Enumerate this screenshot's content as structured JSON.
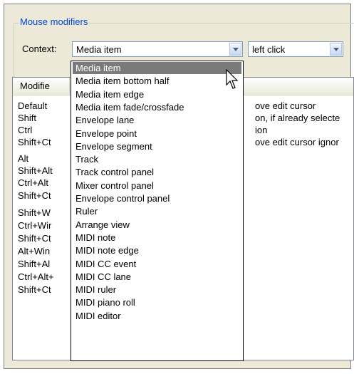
{
  "group_title": "Mouse modifiers",
  "context": {
    "label": "Context:",
    "selected": "Media item",
    "action": "left click"
  },
  "list": {
    "header_modifier": "Modifie",
    "rows": [
      {
        "modifier": "Default",
        "action": "ove edit cursor"
      },
      {
        "modifier": "Shift",
        "action": "on, if already selecte"
      },
      {
        "modifier": "Ctrl",
        "action": "ion"
      },
      {
        "modifier": "Shift+Ct",
        "action": "ove edit cursor ignor"
      },
      {
        "modifier": "Alt",
        "action": ""
      },
      {
        "modifier": "Shift+Alt",
        "action": ""
      },
      {
        "modifier": "Ctrl+Alt",
        "action": ""
      },
      {
        "modifier": "Shift+Ct",
        "action": ""
      },
      {
        "modifier": "Shift+W",
        "action": ""
      },
      {
        "modifier": "Ctrl+Wir",
        "action": ""
      },
      {
        "modifier": "Shift+Ct",
        "action": ""
      },
      {
        "modifier": "Alt+Win",
        "action": ""
      },
      {
        "modifier": "Shift+Al",
        "action": ""
      },
      {
        "modifier": "Ctrl+Alt+",
        "action": ""
      },
      {
        "modifier": "Shift+Ct",
        "action": ""
      }
    ]
  },
  "dropdown_options": [
    "Media item",
    "Media item bottom half",
    "Media item edge",
    "Media item fade/crossfade",
    "Envelope lane",
    "Envelope point",
    "Envelope segment",
    "Track",
    "Track control panel",
    "Mixer control panel",
    "Envelope control panel",
    "Ruler",
    "Arrange view",
    "MIDI note",
    "MIDI note edge",
    "MIDI CC event",
    "MIDI CC lane",
    "MIDI ruler",
    "MIDI piano roll",
    "MIDI editor"
  ]
}
